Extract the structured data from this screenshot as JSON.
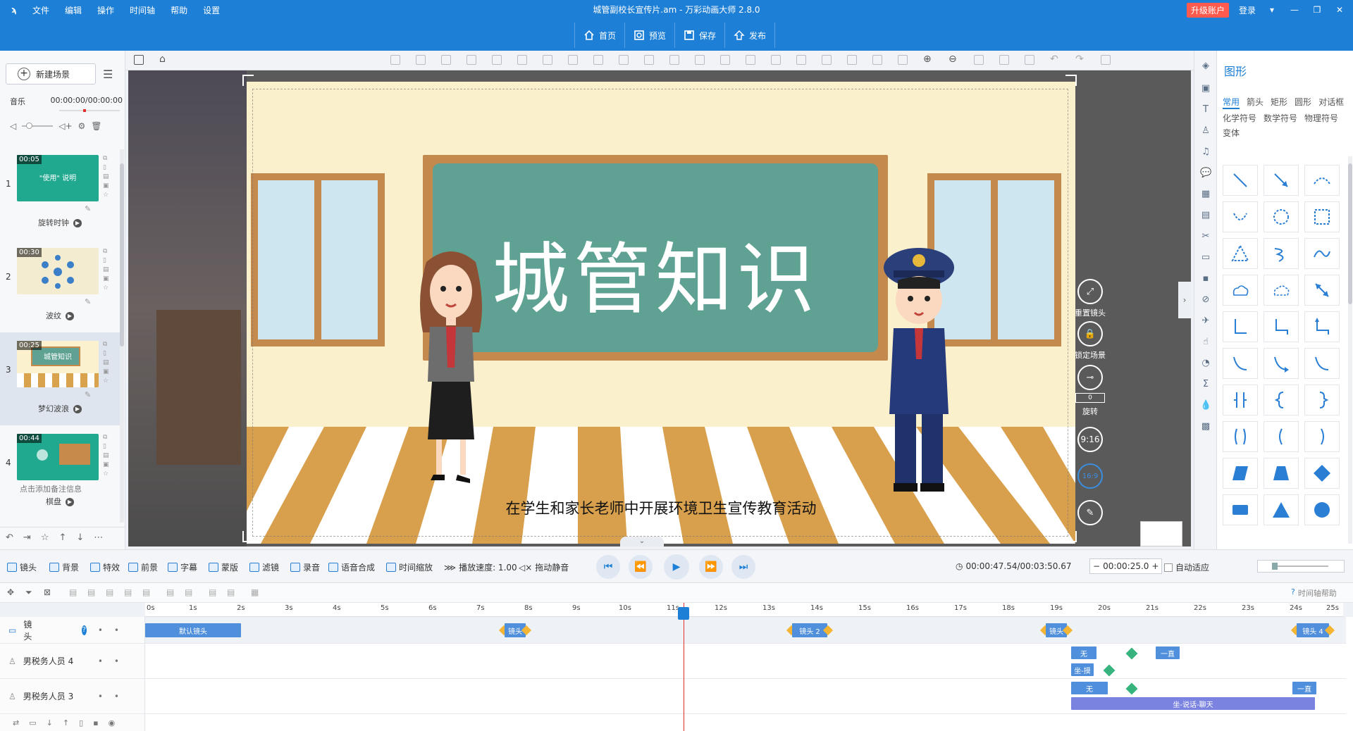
{
  "titlebar": {
    "logo": "ϡ",
    "menu": [
      "文件",
      "编辑",
      "操作",
      "时间轴",
      "帮助",
      "设置"
    ],
    "title": "城管副校长宣传片.am - 万彩动画大师 2.8.0",
    "upgrade": "升级账户",
    "login": "登录"
  },
  "maintoolbar": [
    {
      "icon": "home-icon",
      "label": "首页"
    },
    {
      "icon": "preview-icon",
      "label": "预览"
    },
    {
      "icon": "save-icon",
      "label": "保存"
    },
    {
      "icon": "publish-icon",
      "label": "发布"
    }
  ],
  "left": {
    "new_scene": "新建场景",
    "music_label": "音乐",
    "music_time": "00:00:00/00:00:00",
    "scenes": [
      {
        "num": "1",
        "time": "00:05",
        "thumb_text": "\"使用\" 说明",
        "transition": "旋转时钟"
      },
      {
        "num": "2",
        "time": "00:30",
        "thumb_text": "",
        "transition": "波纹"
      },
      {
        "num": "3",
        "time": "00:25",
        "thumb_text": "城管知识",
        "transition": "梦幻波浪"
      },
      {
        "num": "4",
        "time": "00:44",
        "thumb_text": "",
        "transition": "棋盘",
        "note": "点击添加备注信息"
      }
    ]
  },
  "stage": {
    "board_title": "城管知识",
    "subtitle": "在学生和家长老师中开展环境卫生宣传教育活动"
  },
  "stage_controls": {
    "reset_camera": "重置镜头",
    "lock_scene": "锁定场景",
    "rotate_value": "0",
    "rotate_label": "旋转",
    "ratio_916": "9:16",
    "ratio_169": "16:9"
  },
  "right": {
    "title": "图形",
    "tabs": [
      "常用",
      "箭头",
      "矩形",
      "圆形",
      "对话框",
      "化学符号",
      "数学符号",
      "物理符号",
      "变体"
    ]
  },
  "bottombar": {
    "items": [
      {
        "icon": "camera-icon",
        "label": "镜头"
      },
      {
        "icon": "background-icon",
        "label": "背景"
      },
      {
        "icon": "effect-icon",
        "label": "特效"
      },
      {
        "icon": "foreground-icon",
        "label": "前景"
      },
      {
        "icon": "caption-icon",
        "label": "字幕"
      },
      {
        "icon": "mask-icon",
        "label": "蒙版"
      },
      {
        "icon": "filter-icon",
        "label": "滤镜"
      },
      {
        "icon": "record-icon",
        "label": "录音"
      },
      {
        "icon": "tts-icon",
        "label": "语音合成"
      },
      {
        "icon": "timescale-icon",
        "label": "时间缩放"
      }
    ],
    "speed": "播放速度: 1.00",
    "mute_drag": "拖动静音",
    "time_readout": "00:00:47.54/00:03:50.67",
    "zoom_value": "00:00:25.0",
    "auto_fit": "自动适应",
    "help": "时间轴帮助"
  },
  "timeline": {
    "ticks": [
      "0s",
      "1s",
      "2s",
      "3s",
      "4s",
      "5s",
      "6s",
      "7s",
      "8s",
      "9s",
      "10s",
      "11s",
      "12s",
      "13s",
      "14s",
      "15s",
      "16s",
      "17s",
      "18s",
      "19s",
      "20s",
      "21s",
      "22s",
      "23s",
      "24s",
      "25s"
    ],
    "tracks": [
      {
        "name": "镜头",
        "icon": "camera-icon"
      },
      {
        "name": "男税务人员 4",
        "icon": "person-icon"
      },
      {
        "name": "男税务人员 3",
        "icon": "person-icon"
      }
    ],
    "clips": {
      "default_camera": "默认镜头",
      "cam1": "镜头",
      "cam2": "镜头 2",
      "cam3": "镜头",
      "cam4": "镜头 4",
      "none": "无",
      "sit": "坐-摸",
      "yizhi": "一直",
      "none2": "无",
      "yizhi2": "一直",
      "talk": "坐-说话-聊天"
    }
  },
  "colors": {
    "brand": "#1e7fd6",
    "board": "#5fa294",
    "playhead": "#e03030"
  }
}
